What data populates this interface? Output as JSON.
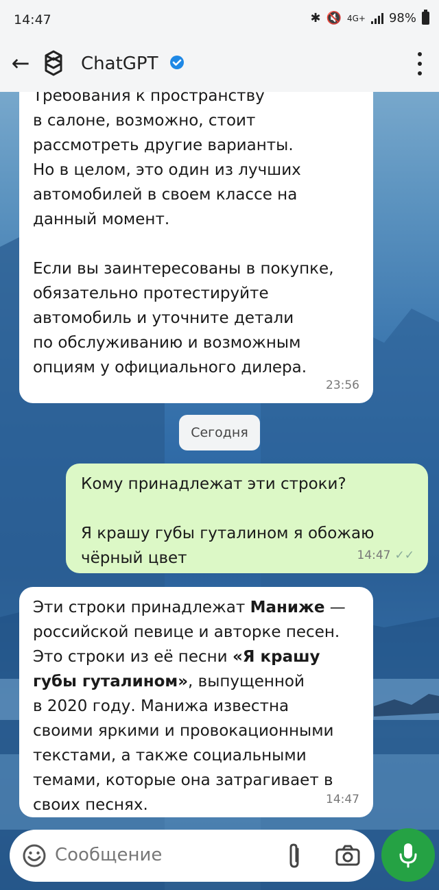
{
  "status_bar": {
    "time": "14:47",
    "network": "4G+",
    "battery": "98%"
  },
  "header": {
    "back_icon": "arrow-left-icon",
    "title": "ChatGPT",
    "verified": true
  },
  "messages": [
    {
      "side": "in",
      "text": "Требования к пространству\nв салоне, возможно, стоит\nрассмотреть другие варианты.\nНо в целом, это один из лучших\nавтомобилей в своем классе на\nданный момент.\n\nЕсли вы заинтересованы в покупке,\nобязательно протестируйте\nавтомобиль и уточните детали\nпо обслуживанию и возможным\nопциям у официального дилера.",
      "time": "23:56"
    },
    {
      "side": "out",
      "text": "Кому принадлежат эти строки?\n\nЯ крашу губы гуталином я обожаю\nчёрный цвет",
      "time": "14:47",
      "read_ticks": "✓✓"
    },
    {
      "side": "in",
      "parts": {
        "p1": "Эти строки принадлежат ",
        "b1": "Манижe",
        "p2": " —\nроссийской певице и авторке песен.\nЭто строки из её песни ",
        "b2": "«Я крашу\nгубы гуталином»",
        "p3": ", выпущенной\nв 2020 году. Манижа известна\nсвоими яркими и провокационными\nтекстами, а также социальными\nтемами, которые она затрагивает в\nсвоих песнях."
      },
      "time": "14:47"
    }
  ],
  "date_separator": "Сегодня",
  "composer": {
    "placeholder": "Сообщение"
  }
}
